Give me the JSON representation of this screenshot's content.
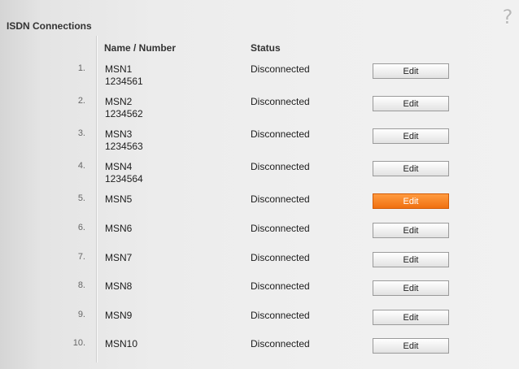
{
  "page": {
    "title": "ISDN Connections",
    "help_icon": "?"
  },
  "table": {
    "headers": {
      "name": "Name / Number",
      "status": "Status"
    },
    "rows": [
      {
        "index": "1.",
        "name": "MSN1",
        "number": "1234561",
        "status": "Disconnected",
        "action": "Edit"
      },
      {
        "index": "2.",
        "name": "MSN2",
        "number": "1234562",
        "status": "Disconnected",
        "action": "Edit"
      },
      {
        "index": "3.",
        "name": "MSN3",
        "number": "1234563",
        "status": "Disconnected",
        "action": "Edit"
      },
      {
        "index": "4.",
        "name": "MSN4",
        "number": "1234564",
        "status": "Disconnected",
        "action": "Edit"
      },
      {
        "index": "5.",
        "name": "MSN5",
        "number": "",
        "status": "Disconnected",
        "action": "Edit"
      },
      {
        "index": "6.",
        "name": "MSN6",
        "number": "",
        "status": "Disconnected",
        "action": "Edit"
      },
      {
        "index": "7.",
        "name": "MSN7",
        "number": "",
        "status": "Disconnected",
        "action": "Edit"
      },
      {
        "index": "8.",
        "name": "MSN8",
        "number": "",
        "status": "Disconnected",
        "action": "Edit"
      },
      {
        "index": "9.",
        "name": "MSN9",
        "number": "",
        "status": "Disconnected",
        "action": "Edit"
      },
      {
        "index": "10.",
        "name": "MSN10",
        "number": "",
        "status": "Disconnected",
        "action": "Edit"
      }
    ]
  },
  "colors": {
    "active_button": "#f07010",
    "background": "#ececec"
  }
}
